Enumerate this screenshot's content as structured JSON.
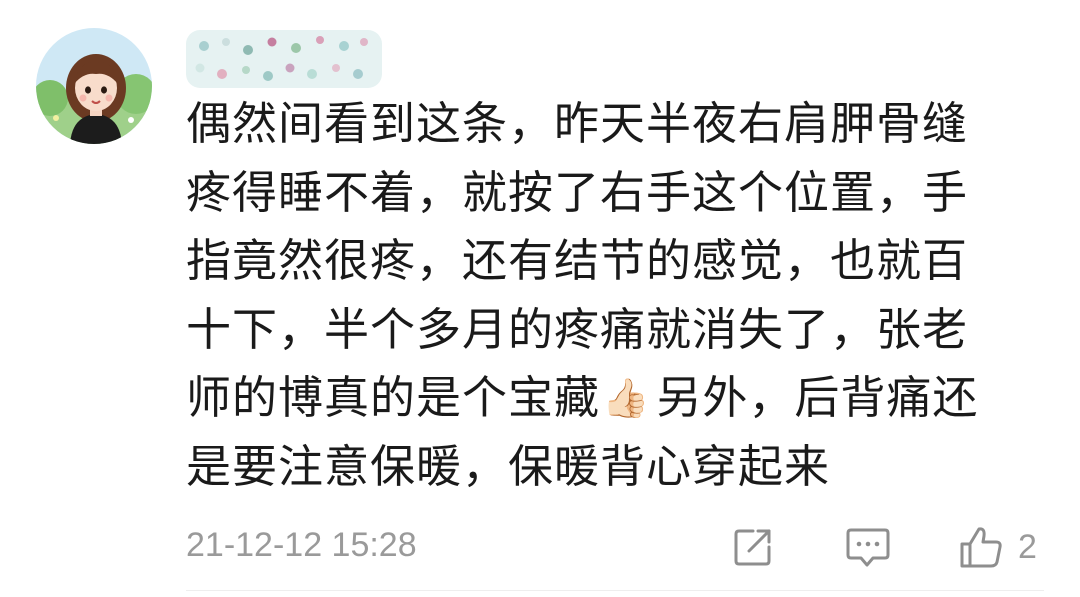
{
  "comment": {
    "lines": [
      "偶然间看到这条，昨天半夜右肩胛骨缝",
      "疼得睡不着，就按了右手这个位置，手",
      "指竟然很疼，还有结节的感觉，也就百",
      "十下，半个多月的疼痛就消失了，张老",
      "师的博真的是个宝藏",
      "另外，后背痛还",
      "是要注意保暖，保暖背心穿起来"
    ],
    "emoji": "👍🏻"
  },
  "footer": {
    "timestamp": "21-12-12 15:28",
    "like_count": "2"
  },
  "icons": {
    "share": "share-icon",
    "reply": "comment-icon",
    "like": "thumbs-up-icon"
  },
  "colors": {
    "text": "#1a1a1a",
    "meta": "#9a9a9a"
  }
}
